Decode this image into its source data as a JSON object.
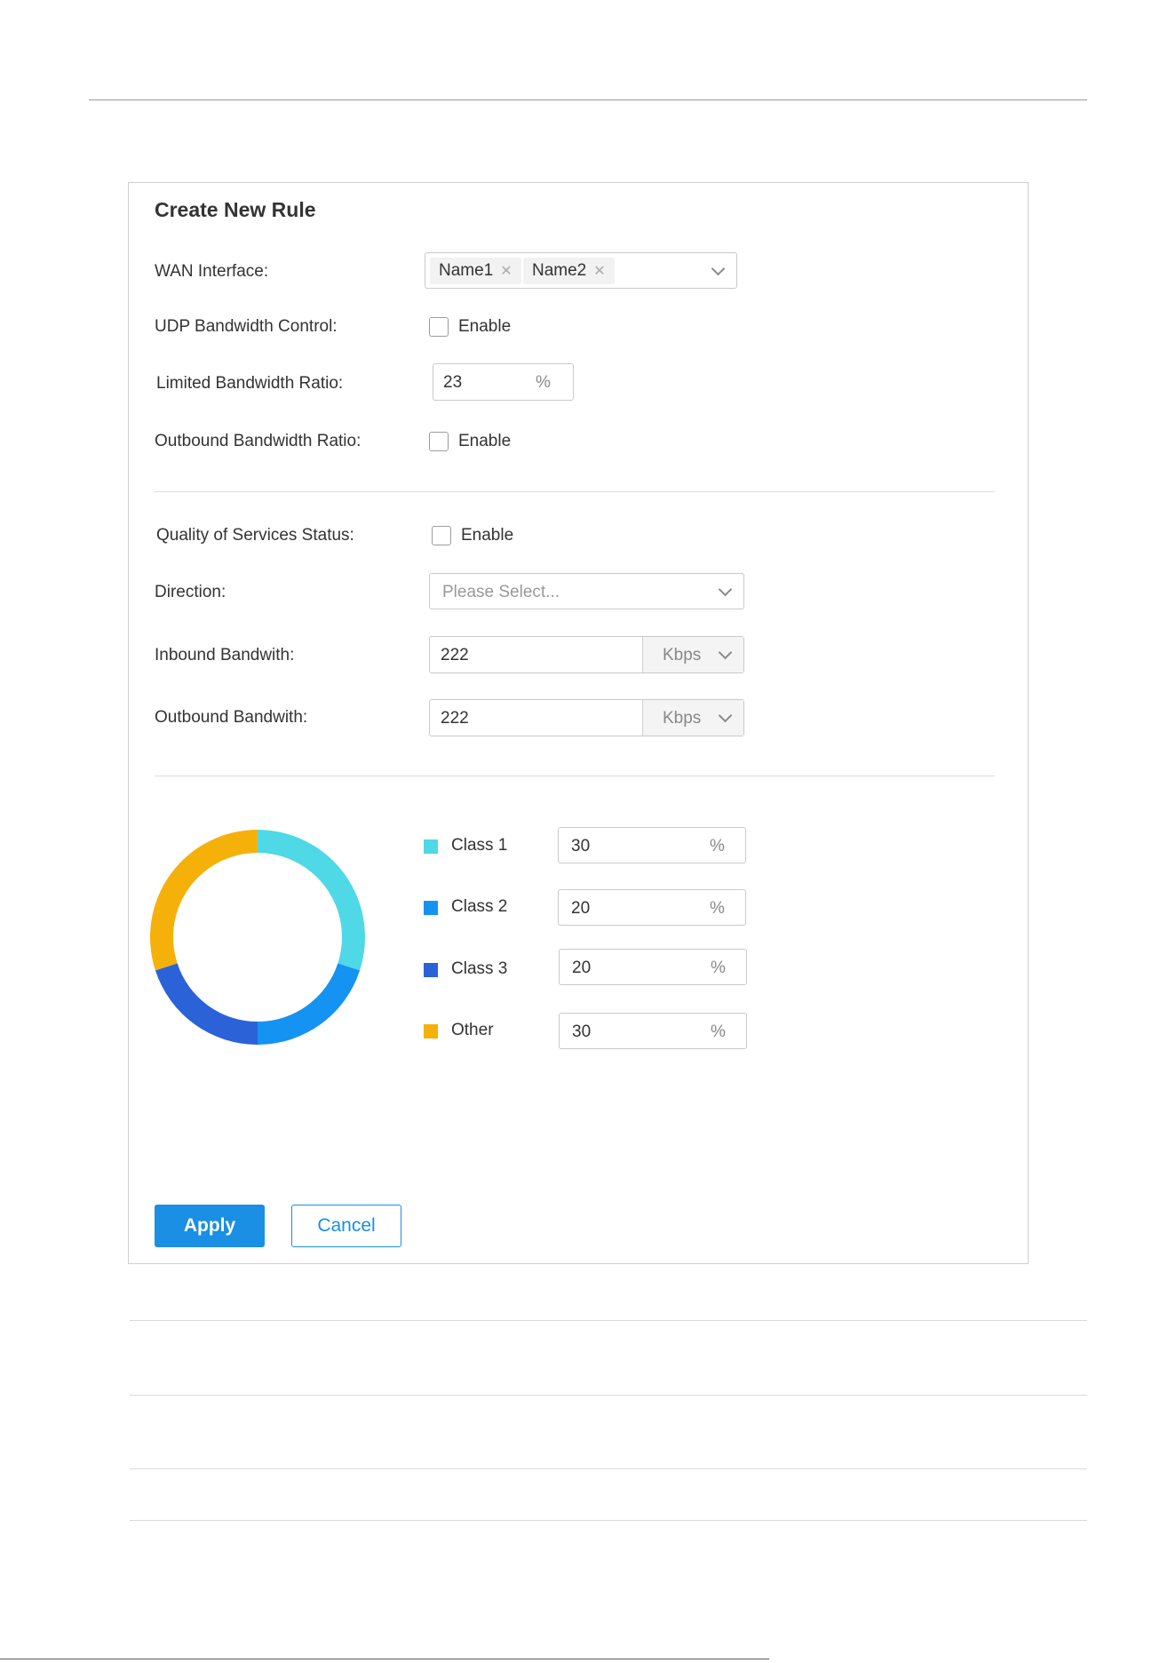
{
  "form": {
    "title": "Create New Rule",
    "wan_label": "WAN Interface:",
    "wan_tags": [
      "Name1",
      "Name2"
    ],
    "udp_label": "UDP Bandwidth Control:",
    "udp_enable": "Enable",
    "limited_label": "Limited Bandwidth Ratio:",
    "limited_value": "23",
    "limited_unit": "%",
    "outbound_ratio_label": "Outbound Bandwidth Ratio:",
    "outbound_ratio_enable": "Enable",
    "qos_label": "Quality of Services Status:",
    "qos_enable": "Enable",
    "direction_label": "Direction:",
    "direction_placeholder": "Please Select...",
    "inbound_label": "Inbound Bandwith:",
    "inbound_value": "222",
    "inbound_unit": "Kbps",
    "outbound_label": "Outbound Bandwith:",
    "outbound_value": "222",
    "outbound_unit": "Kbps"
  },
  "classes": [
    {
      "name": "Class 1",
      "value": "30",
      "unit": "%",
      "color": "#4fd8e6"
    },
    {
      "name": "Class 2",
      "value": "20",
      "unit": "%",
      "color": "#1493f2"
    },
    {
      "name": "Class 3",
      "value": "20",
      "unit": "%",
      "color": "#2c62d8"
    },
    {
      "name": "Other",
      "value": "30",
      "unit": "%",
      "color": "#f5b10a"
    }
  ],
  "buttons": {
    "apply": "Apply",
    "cancel": "Cancel"
  }
}
